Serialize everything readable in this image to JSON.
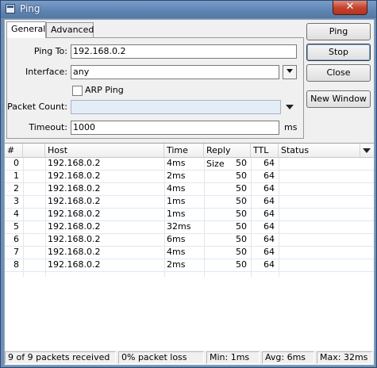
{
  "window": {
    "title": "Ping",
    "close_glyph": "✕"
  },
  "tabs": [
    {
      "label": "General"
    },
    {
      "label": "Advanced"
    }
  ],
  "form": {
    "ping_to": {
      "label": "Ping To:",
      "value": "192.168.0.2"
    },
    "interface": {
      "label": "Interface:",
      "value": "any"
    },
    "arp_ping": {
      "label": "ARP Ping",
      "checked": false
    },
    "packet_count": {
      "label": "Packet Count:",
      "value": ""
    },
    "timeout": {
      "label": "Timeout:",
      "value": "1000",
      "unit": "ms"
    }
  },
  "buttons": {
    "ping": "Ping",
    "stop": "Stop",
    "close": "Close",
    "new_window": "New Window"
  },
  "table": {
    "columns": [
      "#",
      "Host",
      "Time",
      "Reply Size",
      "TTL",
      "Status"
    ],
    "rows": [
      {
        "seq": "0",
        "host": "192.168.0.2",
        "time": "4ms",
        "size": "50",
        "ttl": "64",
        "status": ""
      },
      {
        "seq": "1",
        "host": "192.168.0.2",
        "time": "2ms",
        "size": "50",
        "ttl": "64",
        "status": ""
      },
      {
        "seq": "2",
        "host": "192.168.0.2",
        "time": "4ms",
        "size": "50",
        "ttl": "64",
        "status": ""
      },
      {
        "seq": "3",
        "host": "192.168.0.2",
        "time": "1ms",
        "size": "50",
        "ttl": "64",
        "status": ""
      },
      {
        "seq": "4",
        "host": "192.168.0.2",
        "time": "1ms",
        "size": "50",
        "ttl": "64",
        "status": ""
      },
      {
        "seq": "5",
        "host": "192.168.0.2",
        "time": "32ms",
        "size": "50",
        "ttl": "64",
        "status": ""
      },
      {
        "seq": "6",
        "host": "192.168.0.2",
        "time": "6ms",
        "size": "50",
        "ttl": "64",
        "status": ""
      },
      {
        "seq": "7",
        "host": "192.168.0.2",
        "time": "4ms",
        "size": "50",
        "ttl": "64",
        "status": ""
      },
      {
        "seq": "8",
        "host": "192.168.0.2",
        "time": "2ms",
        "size": "50",
        "ttl": "64",
        "status": ""
      }
    ]
  },
  "status": {
    "received": "9 of 9 packets received",
    "loss": "0% packet loss",
    "min": "Min: 1ms",
    "avg": "Avg: 6ms",
    "max": "Max: 32ms"
  }
}
